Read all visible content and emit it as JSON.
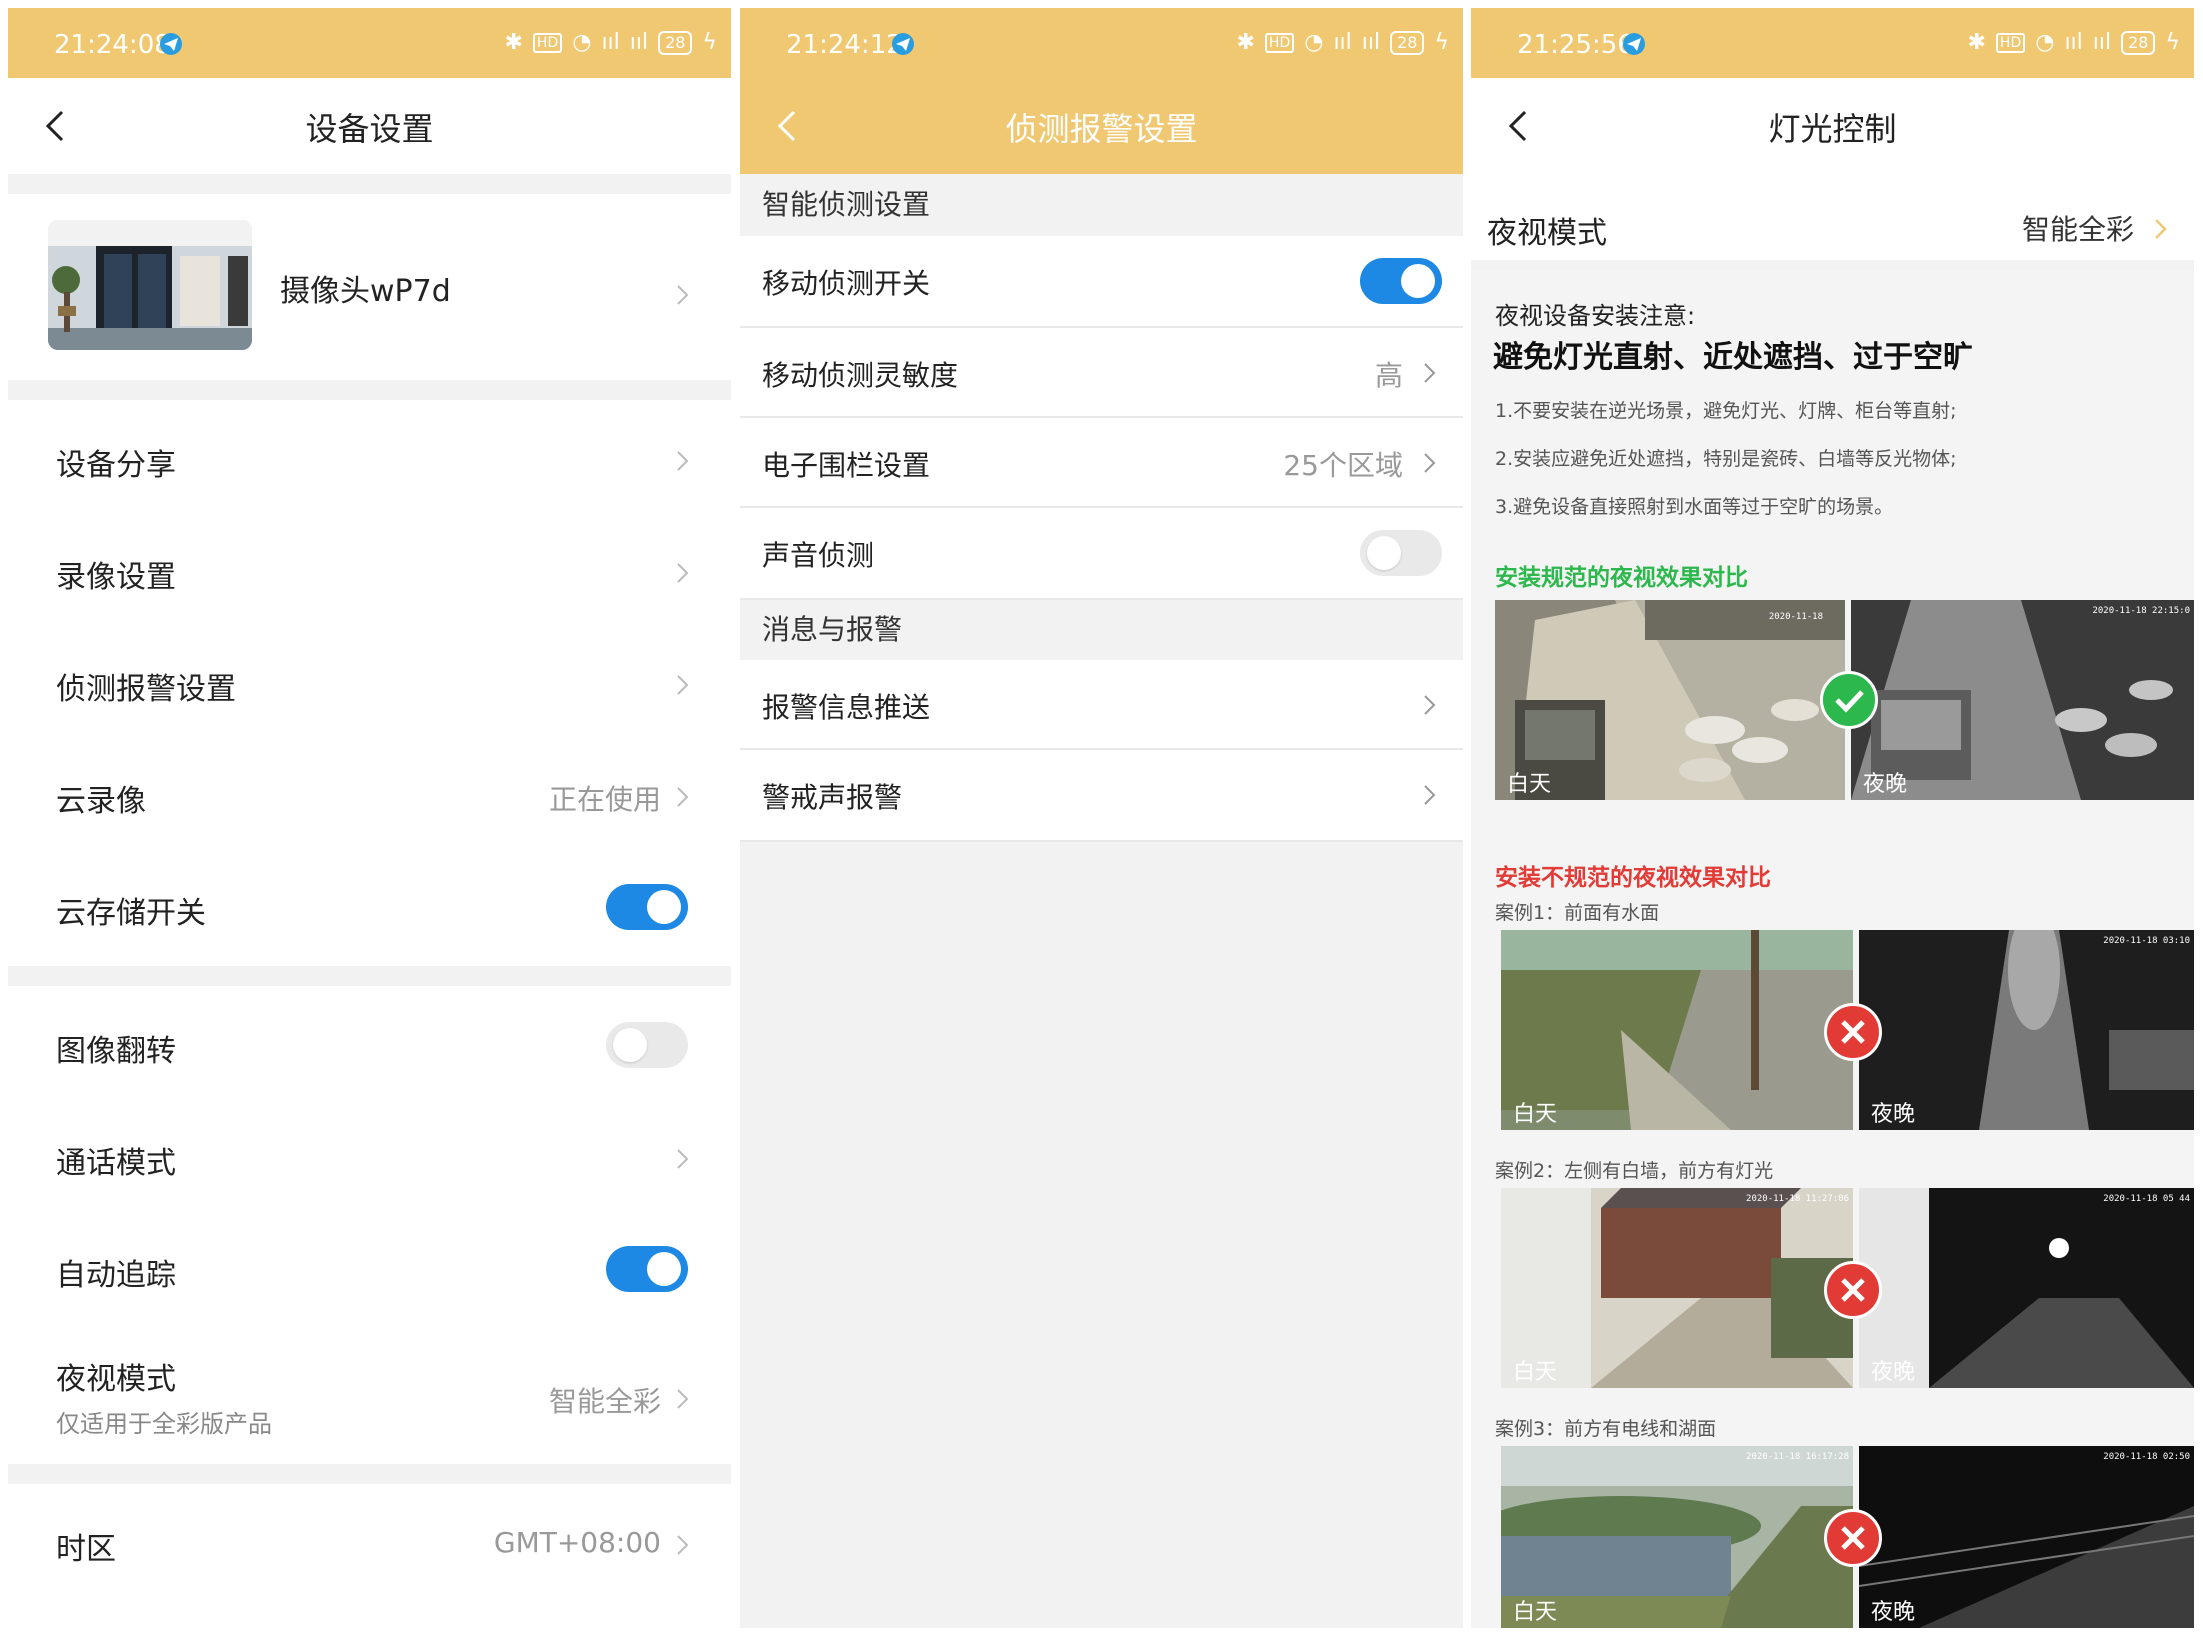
{
  "panel1": {
    "status": {
      "time": "21:24:08",
      "hd": "HD",
      "battery": "28"
    },
    "nav": {
      "title": "设备设置"
    },
    "camera": {
      "name": "摄像头wP7d"
    },
    "rows": {
      "share": "设备分享",
      "record": "录像设置",
      "detect": "侦测报警设置",
      "cloud_record": {
        "label": "云录像",
        "value": "正在使用"
      },
      "cloud_storage": {
        "label": "云存储开关",
        "on": true
      },
      "flip": {
        "label": "图像翻转",
        "on": false
      },
      "talk": "通话模式",
      "track": {
        "label": "自动追踪",
        "on": true
      },
      "night": {
        "label": "夜视模式",
        "sub": "仅适用于全彩版产品",
        "value": "智能全彩"
      },
      "timezone": {
        "label": "时区",
        "value": "GMT+08:00"
      }
    }
  },
  "panel2": {
    "status": {
      "time": "21:24:12",
      "hd": "HD",
      "battery": "28"
    },
    "nav": {
      "title": "侦测报警设置"
    },
    "section1": "智能侦测设置",
    "motion": {
      "label": "移动侦测开关",
      "on": true
    },
    "sensitivity": {
      "label": "移动侦测灵敏度",
      "value": "高"
    },
    "fence": {
      "label": "电子围栏设置",
      "value": "25个区域"
    },
    "sound": {
      "label": "声音侦测",
      "on": false
    },
    "section2": "消息与报警",
    "push": "报警信息推送",
    "siren": "警戒声报警"
  },
  "panel3": {
    "status": {
      "time": "21:25:56",
      "hd": "HD",
      "battery": "28"
    },
    "nav": {
      "title": "灯光控制"
    },
    "night": {
      "label": "夜视模式",
      "value": "智能全彩"
    },
    "notice": {
      "title": "夜视设备安装注意:",
      "headline": "避免灯光直射、近处遮挡、过于空旷",
      "items": [
        "1.不要安装在逆光场景，避免灯光、灯牌、柜台等直射;",
        "2.安装应避免近处遮挡，特别是瓷砖、白墙等反光物体;",
        "3.避免设备直接照射到水面等过于空旷的场景。"
      ]
    },
    "good_title": "安装规范的夜视效果对比",
    "bad_title": "安装不规范的夜视效果对比",
    "day": "白天",
    "night_tag": "夜晚",
    "stamps": {
      "good_day": "2020-11-18",
      "good_night": "2020-11-18 22:15:0",
      "case1_night": "2020-11-18 03:10",
      "case2_day": "2020-11-18 11:27:06",
      "case2_night": "2020-11-18 05 44",
      "case3_day": "2020-11-18 16:17:28",
      "case3_night": "2020-11-18 02:50"
    },
    "cases": [
      "案例1：前面有水面",
      "案例2：左侧有白墙，前方有灯光",
      "案例3：前方有电线和湖面"
    ]
  },
  "colors": {
    "status_bar": "#f0c872",
    "toggle_on": "#1e88e5",
    "good": "#2db84d",
    "bad": "#e23b36"
  }
}
